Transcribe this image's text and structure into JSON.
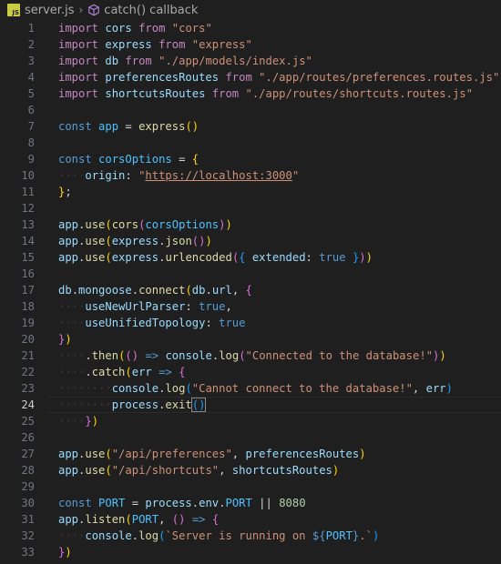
{
  "breadcrumb": {
    "file": "server.js",
    "file_icon": "JS",
    "symbol": "catch() callback"
  },
  "colors": {
    "background": "#1f1f1f",
    "keyword": "#c586c0",
    "declaration": "#569cd6",
    "variable": "#9cdcfe",
    "constant": "#4fc1ff",
    "function": "#dcdcaa",
    "string": "#ce9178",
    "number": "#b5cea8",
    "bracket_level1": "#ffd700",
    "bracket_level2": "#da70d6",
    "bracket_level3": "#179fff"
  },
  "current_line": 24,
  "lines": [
    {
      "n": 1,
      "tokens": [
        [
          "kw",
          "import"
        ],
        [
          "op",
          " "
        ],
        [
          "id",
          "cors"
        ],
        [
          "op",
          " "
        ],
        [
          "kw",
          "from"
        ],
        [
          "op",
          " "
        ],
        [
          "st",
          "\"cors\""
        ]
      ]
    },
    {
      "n": 2,
      "tokens": [
        [
          "kw",
          "import"
        ],
        [
          "op",
          " "
        ],
        [
          "id",
          "express"
        ],
        [
          "op",
          " "
        ],
        [
          "kw",
          "from"
        ],
        [
          "op",
          " "
        ],
        [
          "st",
          "\"express\""
        ]
      ]
    },
    {
      "n": 3,
      "tokens": [
        [
          "kw",
          "import"
        ],
        [
          "op",
          " "
        ],
        [
          "id",
          "db"
        ],
        [
          "op",
          " "
        ],
        [
          "kw",
          "from"
        ],
        [
          "op",
          " "
        ],
        [
          "st",
          "\"./app/models/index.js\""
        ]
      ]
    },
    {
      "n": 4,
      "tokens": [
        [
          "kw",
          "import"
        ],
        [
          "op",
          " "
        ],
        [
          "id",
          "preferencesRoutes"
        ],
        [
          "op",
          " "
        ],
        [
          "kw",
          "from"
        ],
        [
          "op",
          " "
        ],
        [
          "st",
          "\"./app/routes/preferences.routes.js\""
        ]
      ]
    },
    {
      "n": 5,
      "tokens": [
        [
          "kw",
          "import"
        ],
        [
          "op",
          " "
        ],
        [
          "id",
          "shortcutsRoutes"
        ],
        [
          "op",
          " "
        ],
        [
          "kw",
          "from"
        ],
        [
          "op",
          " "
        ],
        [
          "st",
          "\"./app/routes/shortcuts.routes.js\""
        ]
      ]
    },
    {
      "n": 6,
      "tokens": []
    },
    {
      "n": 7,
      "tokens": [
        [
          "dk",
          "const"
        ],
        [
          "op",
          " "
        ],
        [
          "cn",
          "app"
        ],
        [
          "op",
          " = "
        ],
        [
          "fn",
          "express"
        ],
        [
          "b1",
          "()"
        ]
      ]
    },
    {
      "n": 8,
      "tokens": []
    },
    {
      "n": 9,
      "tokens": [
        [
          "dk",
          "const"
        ],
        [
          "op",
          " "
        ],
        [
          "cn",
          "corsOptions"
        ],
        [
          "op",
          " = "
        ],
        [
          "b1",
          "{"
        ]
      ]
    },
    {
      "n": 10,
      "tokens": [
        [
          "ws",
          "····"
        ],
        [
          "id",
          "origin"
        ],
        [
          "op",
          ": "
        ],
        [
          "st",
          "\""
        ],
        [
          "stul",
          "https://localhost:3000"
        ],
        [
          "st",
          "\""
        ]
      ]
    },
    {
      "n": 11,
      "tokens": [
        [
          "b1",
          "}"
        ],
        [
          "op",
          ";"
        ]
      ]
    },
    {
      "n": 12,
      "tokens": []
    },
    {
      "n": 13,
      "tokens": [
        [
          "id",
          "app"
        ],
        [
          "op",
          "."
        ],
        [
          "fn",
          "use"
        ],
        [
          "b1",
          "("
        ],
        [
          "fn",
          "cors"
        ],
        [
          "b2",
          "("
        ],
        [
          "cn",
          "corsOptions"
        ],
        [
          "b2",
          ")"
        ],
        [
          "b1",
          ")"
        ]
      ]
    },
    {
      "n": 14,
      "tokens": [
        [
          "id",
          "app"
        ],
        [
          "op",
          "."
        ],
        [
          "fn",
          "use"
        ],
        [
          "b1",
          "("
        ],
        [
          "id",
          "express"
        ],
        [
          "op",
          "."
        ],
        [
          "fn",
          "json"
        ],
        [
          "b2",
          "()"
        ],
        [
          "b1",
          ")"
        ]
      ]
    },
    {
      "n": 15,
      "tokens": [
        [
          "id",
          "app"
        ],
        [
          "op",
          "."
        ],
        [
          "fn",
          "use"
        ],
        [
          "b1",
          "("
        ],
        [
          "id",
          "express"
        ],
        [
          "op",
          "."
        ],
        [
          "fn",
          "urlencoded"
        ],
        [
          "b2",
          "("
        ],
        [
          "b3",
          "{"
        ],
        [
          "op",
          " "
        ],
        [
          "id",
          "extended"
        ],
        [
          "op",
          ": "
        ],
        [
          "dk",
          "true"
        ],
        [
          "op",
          " "
        ],
        [
          "b3",
          "}"
        ],
        [
          "b2",
          ")"
        ],
        [
          "b1",
          ")"
        ]
      ]
    },
    {
      "n": 16,
      "tokens": []
    },
    {
      "n": 17,
      "tokens": [
        [
          "id",
          "db"
        ],
        [
          "op",
          "."
        ],
        [
          "id",
          "mongoose"
        ],
        [
          "op",
          "."
        ],
        [
          "fn",
          "connect"
        ],
        [
          "b1",
          "("
        ],
        [
          "id",
          "db"
        ],
        [
          "op",
          "."
        ],
        [
          "id",
          "url"
        ],
        [
          "op",
          ", "
        ],
        [
          "b2",
          "{"
        ]
      ]
    },
    {
      "n": 18,
      "tokens": [
        [
          "ws",
          "····"
        ],
        [
          "id",
          "useNewUrlParser"
        ],
        [
          "op",
          ": "
        ],
        [
          "dk",
          "true"
        ],
        [
          "op",
          ","
        ]
      ]
    },
    {
      "n": 19,
      "tokens": [
        [
          "ws",
          "····"
        ],
        [
          "id",
          "useUnifiedTopology"
        ],
        [
          "op",
          ": "
        ],
        [
          "dk",
          "true"
        ]
      ]
    },
    {
      "n": 20,
      "tokens": [
        [
          "b2",
          "}"
        ],
        [
          "b1",
          ")"
        ]
      ]
    },
    {
      "n": 21,
      "tokens": [
        [
          "ws",
          "····"
        ],
        [
          "op",
          "."
        ],
        [
          "fn",
          "then"
        ],
        [
          "b1",
          "("
        ],
        [
          "b2",
          "()"
        ],
        [
          "op",
          " "
        ],
        [
          "dk",
          "=>"
        ],
        [
          "op",
          " "
        ],
        [
          "id",
          "console"
        ],
        [
          "op",
          "."
        ],
        [
          "fn",
          "log"
        ],
        [
          "b2",
          "("
        ],
        [
          "st",
          "\"Connected to the database!\""
        ],
        [
          "b2",
          ")"
        ],
        [
          "b1",
          ")"
        ]
      ]
    },
    {
      "n": 22,
      "tokens": [
        [
          "ws",
          "····"
        ],
        [
          "op",
          "."
        ],
        [
          "fn",
          "catch"
        ],
        [
          "b1",
          "("
        ],
        [
          "id",
          "err"
        ],
        [
          "op",
          " "
        ],
        [
          "dk",
          "=>"
        ],
        [
          "op",
          " "
        ],
        [
          "b2",
          "{"
        ]
      ]
    },
    {
      "n": 23,
      "tokens": [
        [
          "ws",
          "········"
        ],
        [
          "id",
          "console"
        ],
        [
          "op",
          "."
        ],
        [
          "fn",
          "log"
        ],
        [
          "b3",
          "("
        ],
        [
          "st",
          "\"Cannot connect to the database!\""
        ],
        [
          "op",
          ", "
        ],
        [
          "id",
          "err"
        ],
        [
          "b3",
          ")"
        ]
      ]
    },
    {
      "n": 24,
      "tokens": [
        [
          "ws",
          "········"
        ],
        [
          "id",
          "process"
        ],
        [
          "op",
          "."
        ],
        [
          "fn",
          "exit"
        ],
        [
          "b3cur",
          "()"
        ]
      ]
    },
    {
      "n": 25,
      "tokens": [
        [
          "ws",
          "····"
        ],
        [
          "b2",
          "}"
        ],
        [
          "b1",
          ")"
        ]
      ]
    },
    {
      "n": 26,
      "tokens": []
    },
    {
      "n": 27,
      "tokens": [
        [
          "id",
          "app"
        ],
        [
          "op",
          "."
        ],
        [
          "fn",
          "use"
        ],
        [
          "b1",
          "("
        ],
        [
          "st",
          "\"/api/preferences\""
        ],
        [
          "op",
          ", "
        ],
        [
          "id",
          "preferencesRoutes"
        ],
        [
          "b1",
          ")"
        ]
      ]
    },
    {
      "n": 28,
      "tokens": [
        [
          "id",
          "app"
        ],
        [
          "op",
          "."
        ],
        [
          "fn",
          "use"
        ],
        [
          "b1",
          "("
        ],
        [
          "st",
          "\"/api/shortcuts\""
        ],
        [
          "op",
          ", "
        ],
        [
          "id",
          "shortcutsRoutes"
        ],
        [
          "b1",
          ")"
        ]
      ]
    },
    {
      "n": 29,
      "tokens": []
    },
    {
      "n": 30,
      "tokens": [
        [
          "dk",
          "const"
        ],
        [
          "op",
          " "
        ],
        [
          "cn",
          "PORT"
        ],
        [
          "op",
          " = "
        ],
        [
          "id",
          "process"
        ],
        [
          "op",
          "."
        ],
        [
          "id",
          "env"
        ],
        [
          "op",
          "."
        ],
        [
          "cn",
          "PORT"
        ],
        [
          "op",
          " || "
        ],
        [
          "nm",
          "8080"
        ]
      ]
    },
    {
      "n": 31,
      "tokens": [
        [
          "id",
          "app"
        ],
        [
          "op",
          "."
        ],
        [
          "fn",
          "listen"
        ],
        [
          "b1",
          "("
        ],
        [
          "cn",
          "PORT"
        ],
        [
          "op",
          ", "
        ],
        [
          "b2",
          "()"
        ],
        [
          "op",
          " "
        ],
        [
          "dk",
          "=>"
        ],
        [
          "op",
          " "
        ],
        [
          "b2",
          "{"
        ]
      ]
    },
    {
      "n": 32,
      "tokens": [
        [
          "ws",
          "····"
        ],
        [
          "id",
          "console"
        ],
        [
          "op",
          "."
        ],
        [
          "fn",
          "log"
        ],
        [
          "b3",
          "("
        ],
        [
          "st",
          "`Server is running on "
        ],
        [
          "dk",
          "${"
        ],
        [
          "cn",
          "PORT"
        ],
        [
          "dk",
          "}"
        ],
        [
          "st",
          ".`"
        ],
        [
          "b3",
          ")"
        ]
      ]
    },
    {
      "n": 33,
      "tokens": [
        [
          "b2",
          "}"
        ],
        [
          "b1",
          ")"
        ]
      ]
    }
  ]
}
